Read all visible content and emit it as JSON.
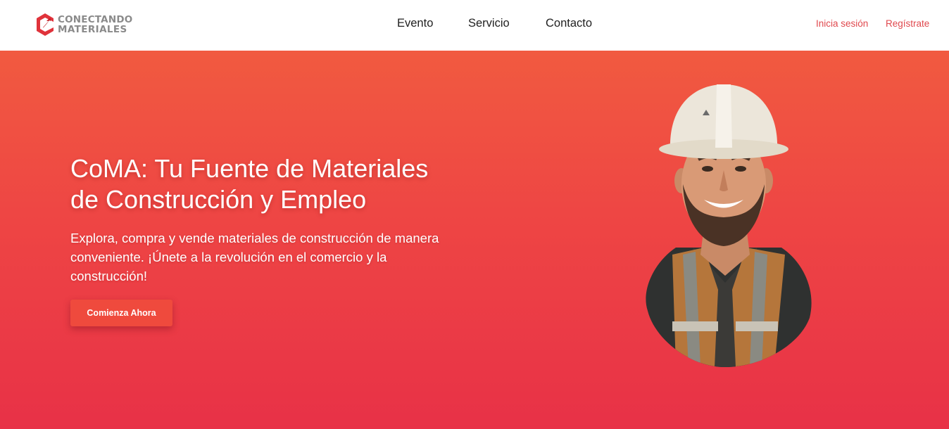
{
  "brand": {
    "line1": "CONECTANDO",
    "line2": "MATERIALES",
    "mark_icon": "coma-logo-icon",
    "mark_color": "#e0333b"
  },
  "nav": {
    "items": [
      {
        "label": "Evento"
      },
      {
        "label": "Servicio"
      },
      {
        "label": "Contacto"
      }
    ]
  },
  "auth": {
    "login_label": "Inicia sesión",
    "signup_label": "Regístrate",
    "color": "#e0484d"
  },
  "hero": {
    "title_line1": "CoMA: Tu Fuente de Materiales",
    "title_line2": "de Construcción y Empleo",
    "subtitle": "Explora, compra y vende materiales de construcción de manera conveniente. ¡Únete a la revolución en el comercio y la construcción!",
    "cta_label": "Comienza Ahora",
    "image": "construction-worker-illustration",
    "gradient_top": "#f15a40",
    "gradient_bottom": "#e83147"
  }
}
